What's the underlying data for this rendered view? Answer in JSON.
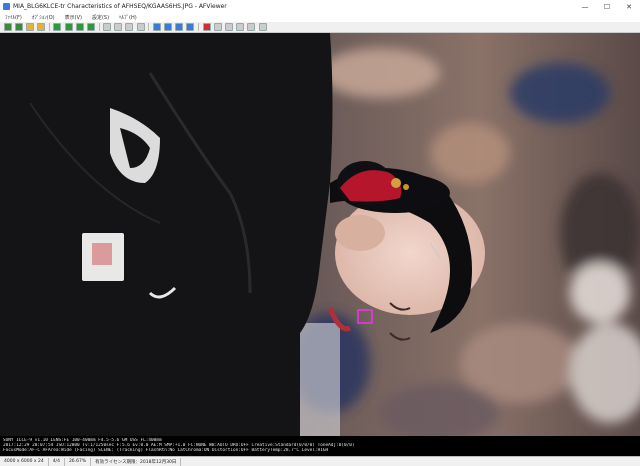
{
  "window": {
    "title": "MIA_BLG6KLCE-tr Characteristics of AFHSEQ/KGAAS6HS.JPG - AFViewer",
    "minimize_glyph": "—",
    "maximize_glyph": "☐",
    "close_glyph": "✕"
  },
  "menu": {
    "items": [
      "ﾌｧｲﾙ(F)",
      "ｵﾌﾟｼｮﾝ(O)",
      "表示(V)",
      "設定(S)",
      "ﾍﾙﾌﾟ(H)"
    ]
  },
  "toolbar": {
    "buttons": [
      {
        "name": "open-icon",
        "color": "#3a8a3a"
      },
      {
        "name": "save-icon",
        "color": "#3a8a3a"
      },
      {
        "name": "folder-icon",
        "color": "#e0b43c"
      },
      {
        "name": "copy-icon",
        "color": "#e0b43c"
      },
      {
        "name": "back-icon",
        "color": "#2b9a3a"
      },
      {
        "name": "forward-icon",
        "color": "#2b9a3a"
      },
      {
        "name": "first-icon",
        "color": "#2b9a3a"
      },
      {
        "name": "last-icon",
        "color": "#2b9a3a"
      },
      {
        "name": "zoom-in-icon",
        "color": "#cccccc"
      },
      {
        "name": "zoom-out-icon",
        "color": "#cccccc"
      },
      {
        "name": "fit-icon",
        "color": "#cccccc"
      },
      {
        "name": "actual-size-icon",
        "color": "#cccccc"
      },
      {
        "name": "rotate-left-icon",
        "color": "#3a7bd5"
      },
      {
        "name": "rotate-right-icon",
        "color": "#3a7bd5"
      },
      {
        "name": "flip-icon",
        "color": "#3a7bd5"
      },
      {
        "name": "slideshow-icon",
        "color": "#3a7bd5"
      },
      {
        "name": "delete-icon",
        "color": "#d03030"
      },
      {
        "name": "info-icon",
        "color": "#cccccc"
      },
      {
        "name": "histogram-icon",
        "color": "#cccccc"
      },
      {
        "name": "settings-icon",
        "color": "#cccccc"
      },
      {
        "name": "print-icon",
        "color": "#cccccc"
      },
      {
        "name": "help-icon",
        "color": "#cccccc"
      }
    ]
  },
  "exif": {
    "line1": "SONY  ILCE-9 v1.10   LENS:FE 100-400mm F4.5-5.6 GM OSS  FL:400mm",
    "line2": "2017:12:29 20:07:54  ISO:12800   Tv:1/1250sec  F:5.6   Ev:0.0    AE:M   SMP:+1.0  FC:NONE  WB:AUTO  DRO:OFF  Creative:Standard(0/0/0)  ToneAdj:0(0/0)",
    "line3": "FocusMode:AF-C  AFArea:Wide  (Facing)  SCENE:  (Tracking)  FlashRtn:No  LatChroma:ON  Distortion:OFF  BatteryTemp:28.7°C  Level:HIGH"
  },
  "status": {
    "dimensions": "4000 x 6000 x 24",
    "index": "4/4",
    "zoom": "26.67%",
    "license": "有効ライセンス期限：2018年12月30日"
  }
}
